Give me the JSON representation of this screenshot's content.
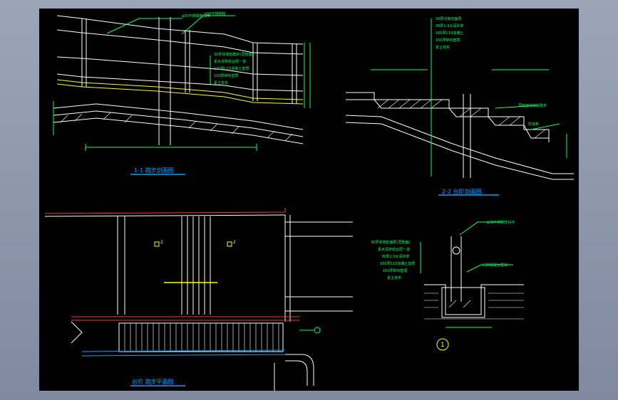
{
  "colors": {
    "background": "#000000",
    "frame": "#8a95a8",
    "line_white": "#ffffff",
    "line_green": "#00ff66",
    "line_yellow": "#ffff00",
    "line_red": "#ff3333",
    "title_blue": "#00a0ff"
  },
  "section_1_1": {
    "title": "1-1 踏步剖面图",
    "callout_top_a": "φ50不锈钢管扶手",
    "callout_top_b": "φ50不锈钢管",
    "layers": [
      "30厚花岗岩踏步(荔枝面)",
      "素水泥浆结合层一道",
      "100厚C15混凝土垫层",
      "100厚碎石垫层",
      "素土夯实"
    ]
  },
  "section_2_2": {
    "title": "2-2 台阶剖面图",
    "layers": [
      "30厚花岗岩面层",
      "30厚1:3水泥砂浆",
      "100厚C15混凝土",
      "150厚碎石垫层",
      "素土夯实"
    ],
    "callout_a": "荔枝面花岗岩踏步",
    "callout_b": "防滑条"
  },
  "plan": {
    "title": "台阶 踏步平面图",
    "marker_2a": "2",
    "marker_2b": "2"
  },
  "detail_1": {
    "callout_top": "φ50不锈钢管扶手",
    "layers": [
      "30厚花岗岩面层(荔枝面)",
      "素水泥浆结合层一道",
      "30厚1:3水泥砂浆",
      "100厚C15混凝土垫层",
      "150厚碎石垫层",
      "素土夯实"
    ],
    "callout_right": "C20混凝土基础",
    "marker": "1"
  }
}
